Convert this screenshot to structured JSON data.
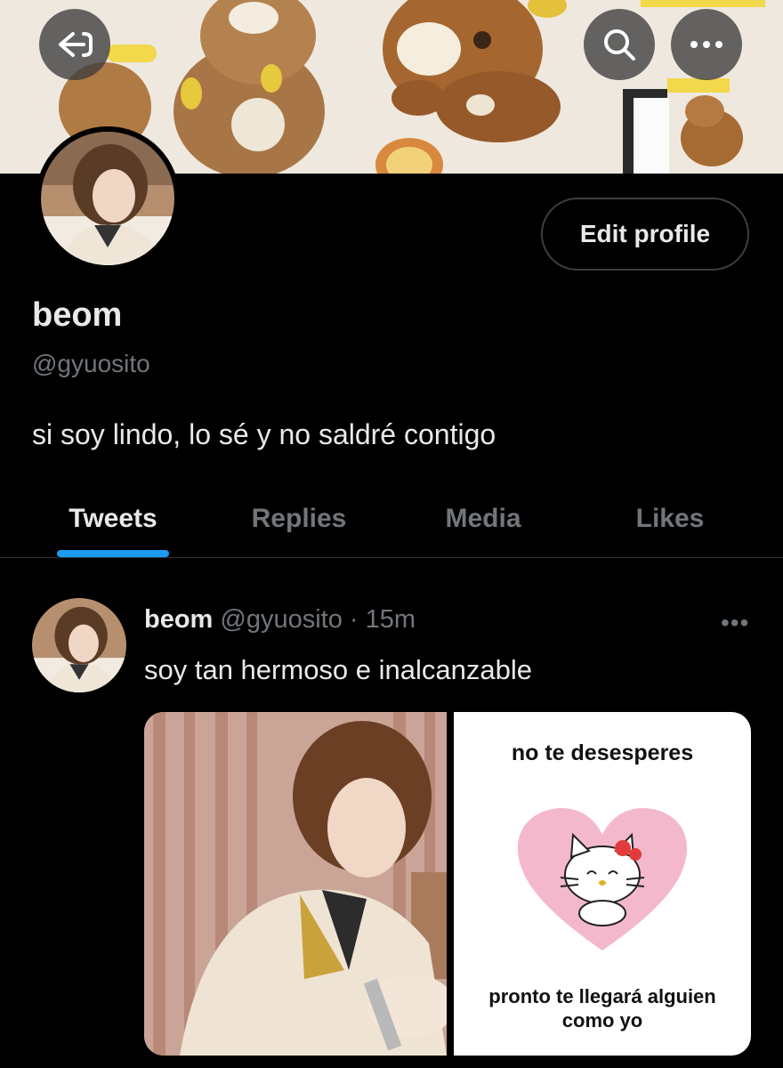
{
  "header": {
    "back_icon": "back-arrow-icon",
    "search_icon": "search-icon",
    "more_icon": "more-icon"
  },
  "profile": {
    "name": "beom",
    "handle": "@gyuosito",
    "bio": "si soy lindo, lo sé y no saldré contigo",
    "edit_button": "Edit profile"
  },
  "tabs": [
    {
      "label": "Tweets",
      "active": true
    },
    {
      "label": "Replies",
      "active": false
    },
    {
      "label": "Media",
      "active": false
    },
    {
      "label": "Likes",
      "active": false
    }
  ],
  "tweet": {
    "name": "beom",
    "handle": "@gyuosito",
    "separator": "·",
    "time": "15m",
    "text": "soy tan hermoso e inalcanzable",
    "more": "•••",
    "meme_top": "no te desesperes",
    "meme_bottom_1": "pronto te llegará alguien",
    "meme_bottom_2": "como yo"
  },
  "colors": {
    "background": "#000000",
    "accent": "#1d9bf0",
    "text_primary": "#e7e9ea",
    "text_secondary": "#71767b",
    "heart_pink": "#f4b8cc"
  }
}
